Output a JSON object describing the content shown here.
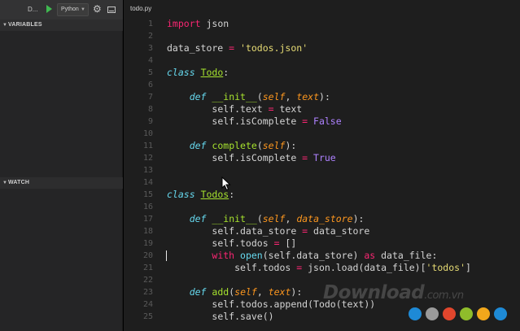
{
  "toolbar": {
    "debug_label": "D...",
    "config_select": "Python",
    "play_icon": "play-icon",
    "gear_icon": "gear-icon",
    "console_icon": "debug-console-icon"
  },
  "sidebar": {
    "variables_header": "VARIABLES",
    "watch_header": "WATCH"
  },
  "editor": {
    "tab_title": "todo.py",
    "current_line": 20,
    "lines": [
      {
        "n": "1"
      },
      {
        "n": "2"
      },
      {
        "n": "3"
      },
      {
        "n": "4"
      },
      {
        "n": "5"
      },
      {
        "n": "6"
      },
      {
        "n": "7"
      },
      {
        "n": "8"
      },
      {
        "n": "9"
      },
      {
        "n": "10"
      },
      {
        "n": "11"
      },
      {
        "n": "12"
      },
      {
        "n": "13"
      },
      {
        "n": "14"
      },
      {
        "n": "15"
      },
      {
        "n": "16"
      },
      {
        "n": "17"
      },
      {
        "n": "18"
      },
      {
        "n": "19"
      },
      {
        "n": "20"
      },
      {
        "n": "21"
      },
      {
        "n": "22"
      },
      {
        "n": "23"
      },
      {
        "n": "24"
      },
      {
        "n": "25"
      }
    ],
    "code": {
      "l1_kw": "import",
      "l1_rest": " json",
      "l3_a": "data_store ",
      "l3_op": "=",
      "l3_str": " 'todos.json'",
      "l5_kw": "class",
      "l5_name": "Todo",
      "l5_end": ":",
      "l7_def": "def",
      "l7_fn": "__init__",
      "l7_a": "(",
      "l7_p1": "self",
      "l7_b": ", ",
      "l7_p2": "text",
      "l7_c": "):",
      "l8_a": "self.text ",
      "l8_op": "=",
      "l8_b": " text",
      "l9_a": "self.isComplete ",
      "l9_op": "=",
      "l9_val": " False",
      "l11_def": "def",
      "l11_fn": "complete",
      "l11_a": "(",
      "l11_p1": "self",
      "l11_c": "):",
      "l12_a": "self.isComplete ",
      "l12_op": "=",
      "l12_val": " True",
      "l15_kw": "class",
      "l15_name": "Todos",
      "l15_end": ":",
      "l17_def": "def",
      "l17_fn": "__init__",
      "l17_a": "(",
      "l17_p1": "self",
      "l17_b": ", ",
      "l17_p2": "data_store",
      "l17_c": "):",
      "l18_a": "self.data_store ",
      "l18_op": "=",
      "l18_b": " data_store",
      "l19_a": "self.todos ",
      "l19_op": "=",
      "l19_b": " []",
      "l20_kw": "with",
      "l20_bi": " open",
      "l20_a": "(self.data_store) ",
      "l20_as": "as",
      "l20_b": " data_file:",
      "l21_a": "self.todos ",
      "l21_op": "=",
      "l21_b": " json.load(data_file)[",
      "l21_str": "'todos'",
      "l21_c": "]",
      "l23_def": "def",
      "l23_fn": "add",
      "l23_a": "(",
      "l23_p1": "self",
      "l23_b": ", ",
      "l23_p2": "text",
      "l23_c": "):",
      "l24_a": "self.todos.append(Todo(text))",
      "l25_a": "self.save()"
    }
  },
  "watermark": {
    "brand": "Download",
    "suffix": ".com.vn",
    "dot_colors": [
      "#1e8ad6",
      "#9a9a9a",
      "#e1462d",
      "#8fbc2b",
      "#f2a71b",
      "#1e8ad6"
    ]
  },
  "colors": {
    "keyword": "#f92672",
    "storage": "#66d9ef",
    "function": "#a6e22e",
    "param": "#fd971f",
    "string": "#e6db74",
    "constant": "#ae81ff"
  }
}
